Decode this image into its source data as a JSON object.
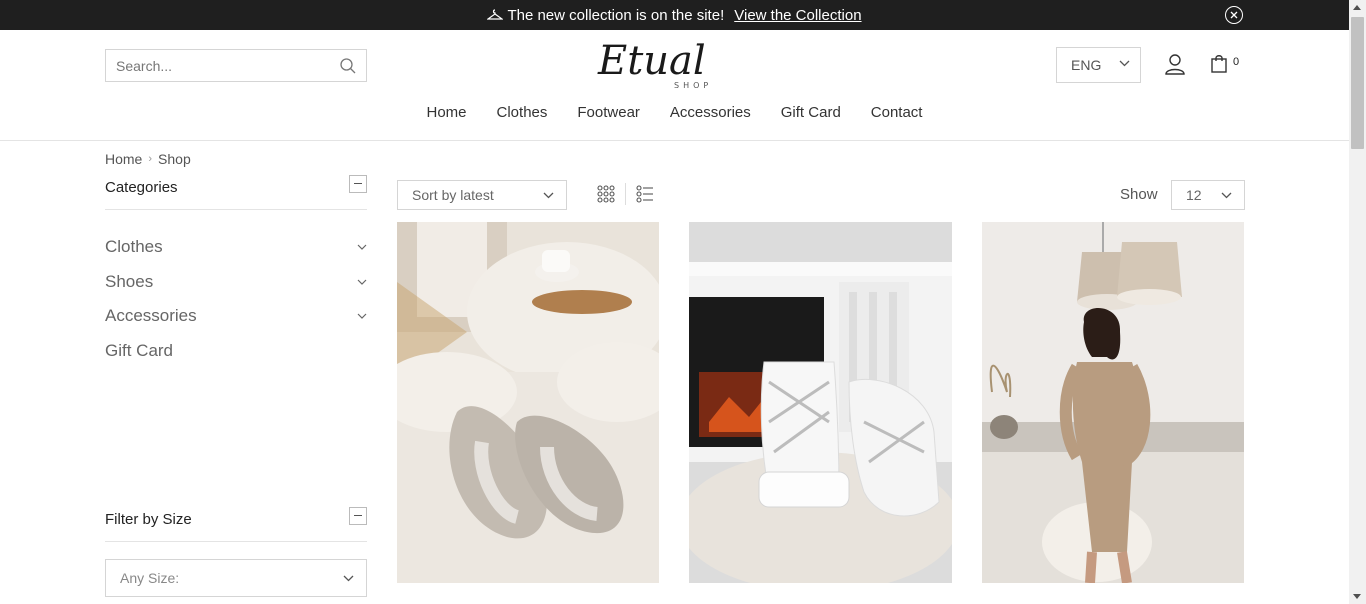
{
  "announcement": {
    "text": "The new collection is on the site!",
    "link": "View the Collection"
  },
  "header": {
    "search_placeholder": "Search...",
    "logo": "Etual Shop",
    "language": "ENG",
    "cart_count": "0"
  },
  "nav": {
    "items": [
      "Home",
      "Clothes",
      "Footwear",
      "Accessories",
      "Gift Card",
      "Contact"
    ]
  },
  "breadcrumb": {
    "home": "Home",
    "current": "Shop"
  },
  "sidebar": {
    "categories_title": "Categories",
    "categories": [
      "Clothes",
      "Shoes",
      "Accessories",
      "Gift Card"
    ],
    "filter_size_title": "Filter by Size",
    "size_placeholder": "Any Size:"
  },
  "toolbar": {
    "sort_value": "Sort by latest",
    "show_label": "Show",
    "show_value": "12"
  },
  "products": [
    {
      "name": "fur-slippers-image"
    },
    {
      "name": "white-fur-boots-image"
    },
    {
      "name": "beige-knit-dress-image"
    }
  ],
  "colors": {
    "announcement_bg": "#1f1f1f",
    "border": "#d5d5d5",
    "text": "#333333"
  }
}
